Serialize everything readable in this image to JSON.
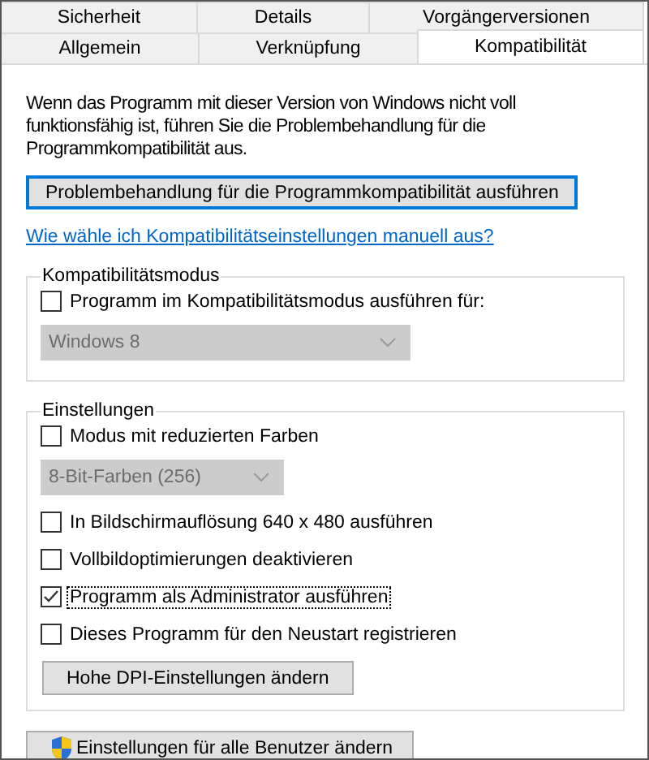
{
  "tab_rows": [
    [
      {
        "label": "Sicherheit",
        "selected": false
      },
      {
        "label": "Details",
        "selected": false
      },
      {
        "label": "Vorgängerversionen",
        "selected": false
      }
    ],
    [
      {
        "label": "Allgemein",
        "selected": false
      },
      {
        "label": "Verknüpfung",
        "selected": false
      },
      {
        "label": "Kompatibilität",
        "selected": true
      }
    ]
  ],
  "description": "Wenn das Programm mit dieser Version von Windows nicht voll funktionsfähig ist, führen Sie die Problembehandlung für die Programmkompatibilität aus.",
  "troubleshoot_button": {
    "label": "Problembehandlung für die Programmkompatibilität ausführen",
    "focused": true
  },
  "help_link": "Wie wähle ich Kompatibilitätseinstellungen manuell aus?",
  "compat_group": {
    "title": "Kompatibilitätsmodus",
    "items": [
      {
        "kind": "checkbox",
        "label": "Programm im Kompatibilitätsmodus ausführen für:",
        "checked": false,
        "focused": false
      },
      {
        "kind": "dropdown",
        "value": "Windows 8",
        "disabled": true
      }
    ]
  },
  "settings_group": {
    "title": "Einstellungen",
    "items": [
      {
        "kind": "checkbox",
        "label": "Modus mit reduzierten Farben",
        "checked": false,
        "focused": false
      },
      {
        "kind": "dropdown",
        "value": "8-Bit-Farben (256)",
        "disabled": true
      },
      {
        "kind": "checkbox",
        "label": "In Bildschirmauflösung 640 x 480 ausführen",
        "checked": false,
        "focused": false
      },
      {
        "kind": "checkbox",
        "label": "Vollbildoptimierungen deaktivieren",
        "checked": false,
        "focused": false
      },
      {
        "kind": "checkbox",
        "label": "Programm als Administrator ausführen",
        "checked": true,
        "focused": true
      },
      {
        "kind": "checkbox",
        "label": "Dieses Programm für den Neustart registrieren",
        "checked": false,
        "focused": false
      },
      {
        "kind": "button",
        "label": "Hohe DPI-Einstellungen ändern",
        "focused": false
      }
    ]
  },
  "all_users_button": {
    "label": "Einstellungen für alle Benutzer ändern",
    "focused": false
  }
}
